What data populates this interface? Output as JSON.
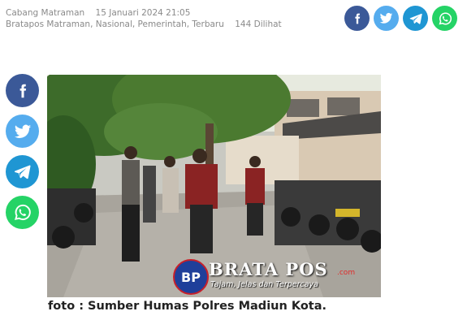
{
  "meta": {
    "location": "Cabang Matraman",
    "date": "15 Januari 2024 21:05",
    "categories": "Bratapos Matraman, Nasional, Pemerintah, Terbaru",
    "views": "144 Dilihat"
  },
  "share": {
    "buttons": [
      {
        "network": "facebook",
        "icon": "facebook-icon",
        "color": "#3b5998"
      },
      {
        "network": "twitter",
        "icon": "twitter-icon",
        "color": "#55acee"
      },
      {
        "network": "telegram",
        "icon": "telegram-icon",
        "color": "#1f96d3"
      },
      {
        "network": "whatsapp",
        "icon": "whatsapp-icon",
        "color": "#25d366"
      }
    ]
  },
  "photo": {
    "watermark_bp": "BP",
    "watermark_brand": "BRATA POS",
    "watermark_domain": ".com",
    "watermark_tagline": "Tajam, Jelas dan Terpercaya"
  },
  "caption": "foto : Sumber Humas Polres Madiun Kota."
}
